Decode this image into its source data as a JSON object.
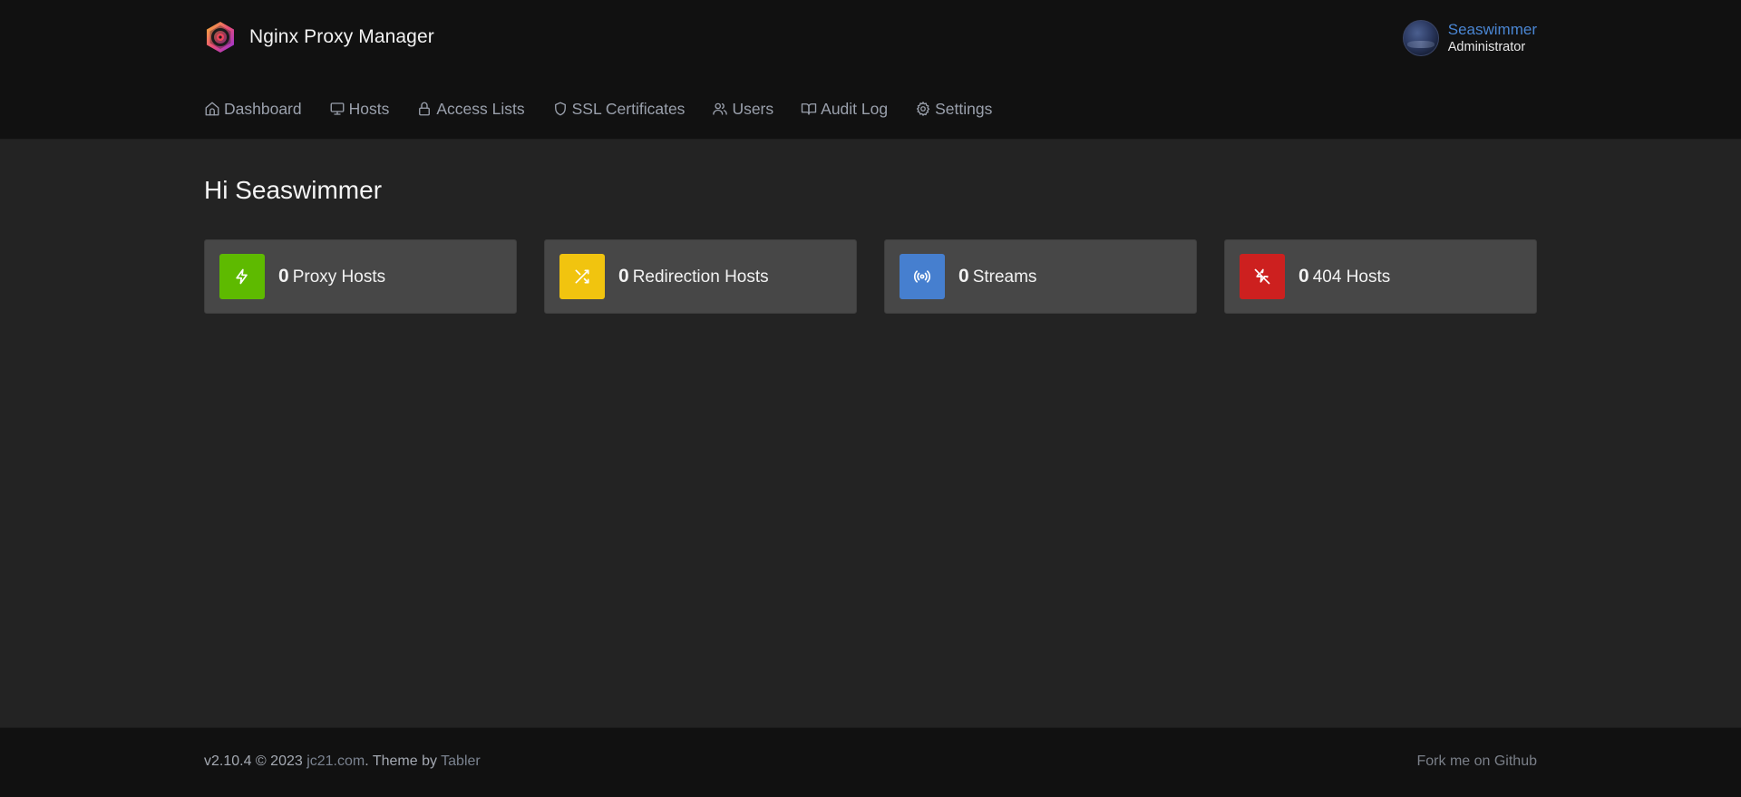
{
  "app": {
    "title": "Nginx Proxy Manager",
    "logo_icon": "nginx-proxy-manager-logo"
  },
  "user": {
    "name": "Seaswimmer",
    "role": "Administrator",
    "avatar": "user-avatar"
  },
  "nav": {
    "items": [
      {
        "label": "Dashboard",
        "icon": "home-icon"
      },
      {
        "label": "Hosts",
        "icon": "monitor-icon"
      },
      {
        "label": "Access Lists",
        "icon": "lock-icon"
      },
      {
        "label": "SSL Certificates",
        "icon": "shield-icon"
      },
      {
        "label": "Users",
        "icon": "users-icon"
      },
      {
        "label": "Audit Log",
        "icon": "book-open-icon"
      },
      {
        "label": "Settings",
        "icon": "settings-icon"
      }
    ]
  },
  "main": {
    "greeting": "Hi Seaswimmer",
    "cards": [
      {
        "count": "0",
        "label": "Proxy Hosts",
        "icon": "zap-icon",
        "color": "#5eba00"
      },
      {
        "count": "0",
        "label": "Redirection Hosts",
        "icon": "shuffle-icon",
        "color": "#f1c40f"
      },
      {
        "count": "0",
        "label": "Streams",
        "icon": "radio-icon",
        "color": "#467fcf"
      },
      {
        "count": "0",
        "label": "404 Hosts",
        "icon": "zap-off-icon",
        "color": "#cd201f"
      }
    ]
  },
  "footer": {
    "version_text": "v2.10.4 © 2023 ",
    "author_link": "jc21.com",
    "theme_text": ". Theme by ",
    "theme_link": "Tabler",
    "github_link": "Fork me on Github"
  },
  "colors": {
    "header_bg": "#111111",
    "page_bg": "#232323",
    "card_bg": "#474747",
    "accent": "#4a86d3"
  }
}
